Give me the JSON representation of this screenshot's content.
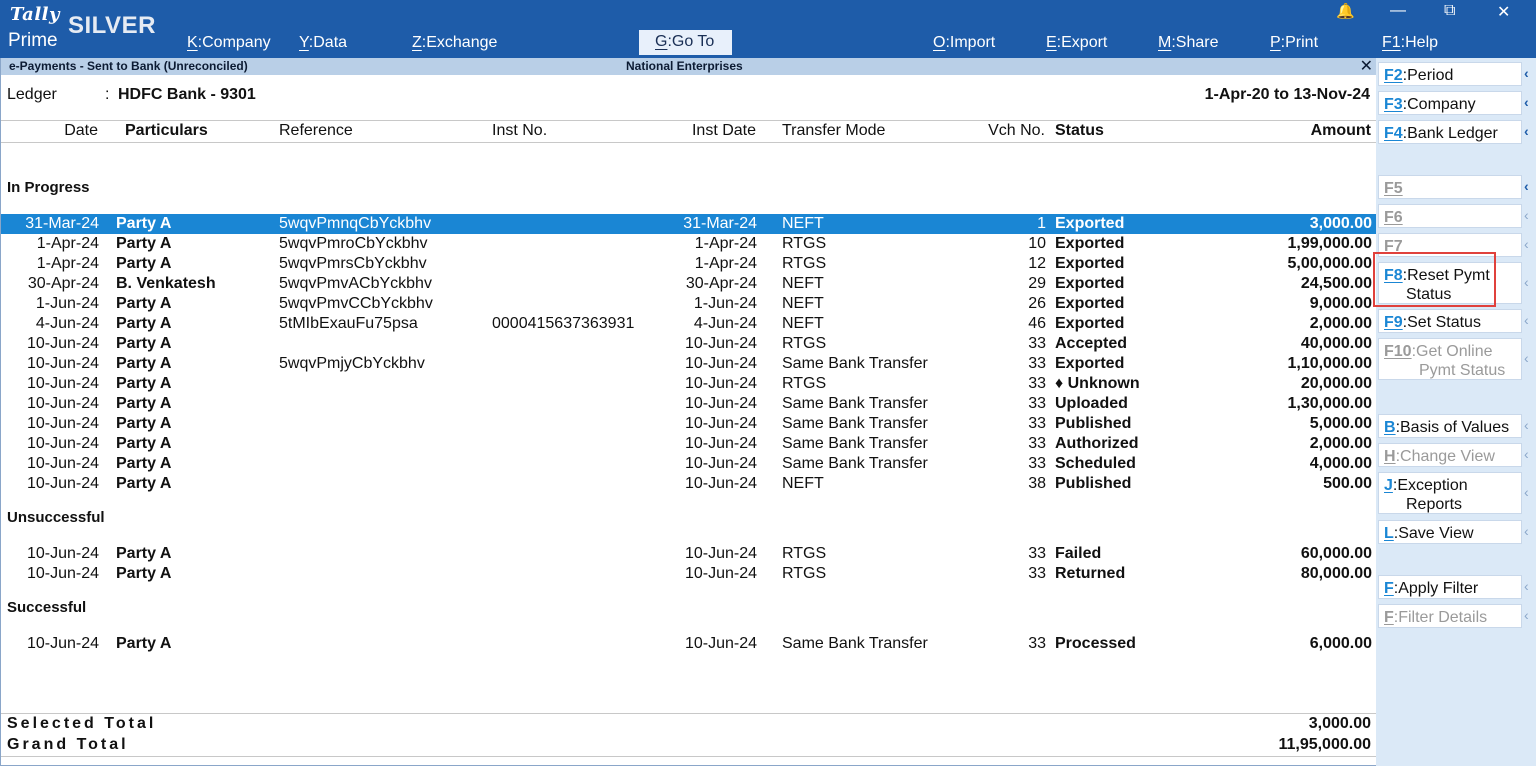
{
  "brand": {
    "tally": "Tally",
    "prime": "Prime",
    "edition": "SILVER"
  },
  "menu": [
    {
      "key": "K",
      "label": ":Company"
    },
    {
      "key": "Y",
      "label": ":Data"
    },
    {
      "key": "Z",
      "label": ":Exchange"
    },
    {
      "key": "G",
      "label": ":Go To"
    },
    {
      "key": "O",
      "label": ":Import"
    },
    {
      "key": "E",
      "label": ":Export"
    },
    {
      "key": "M",
      "label": ":Share"
    },
    {
      "key": "P",
      "label": ":Print"
    },
    {
      "key": "F1",
      "label": ":Help"
    }
  ],
  "window": {
    "bell": "🔔",
    "minimize": "—",
    "restore": "⧉",
    "close": "✕"
  },
  "report": {
    "title": "e-Payments - Sent to Bank (Unreconciled)",
    "company": "National Enterprises",
    "close": "✕",
    "ledger_label": "Ledger",
    "ledger_colon": ":",
    "ledger_value": "HDFC Bank - 9301",
    "period": "1-Apr-20 to 13-Nov-24"
  },
  "columns": {
    "date": "Date",
    "particulars": "Particulars",
    "reference": "Reference",
    "inst_no": "Inst No.",
    "inst_date": "Inst Date",
    "transfer_mode": "Transfer Mode",
    "vch_no": "Vch No.",
    "status": "Status",
    "amount": "Amount"
  },
  "sections": {
    "in_progress": "In Progress",
    "unsuccessful": "Unsuccessful",
    "successful": "Successful"
  },
  "rows_in_progress": [
    {
      "date": "31-Mar-24",
      "party": "Party A",
      "ref": "5wqvPmnqCbYckbhv",
      "inst": "",
      "idate": "31-Mar-24",
      "mode": "NEFT",
      "vch": "1",
      "status": "Exported",
      "amount": "3,000.00"
    },
    {
      "date": "1-Apr-24",
      "party": "Party A",
      "ref": "5wqvPmroCbYckbhv",
      "inst": "",
      "idate": "1-Apr-24",
      "mode": "RTGS",
      "vch": "10",
      "status": "Exported",
      "amount": "1,99,000.00"
    },
    {
      "date": "1-Apr-24",
      "party": "Party A",
      "ref": "5wqvPmrsCbYckbhv",
      "inst": "",
      "idate": "1-Apr-24",
      "mode": "RTGS",
      "vch": "12",
      "status": "Exported",
      "amount": "5,00,000.00"
    },
    {
      "date": "30-Apr-24",
      "party": "B. Venkatesh",
      "ref": "5wqvPmvACbYckbhv",
      "inst": "",
      "idate": "30-Apr-24",
      "mode": "NEFT",
      "vch": "29",
      "status": "Exported",
      "amount": "24,500.00"
    },
    {
      "date": "1-Jun-24",
      "party": "Party A",
      "ref": "5wqvPmvCCbYckbhv",
      "inst": "",
      "idate": "1-Jun-24",
      "mode": "NEFT",
      "vch": "26",
      "status": "Exported",
      "amount": "9,000.00"
    },
    {
      "date": "4-Jun-24",
      "party": "Party A",
      "ref": "5tMIbExauFu75psa",
      "inst": "0000415637363931",
      "idate": "4-Jun-24",
      "mode": "NEFT",
      "vch": "46",
      "status": "Exported",
      "amount": "2,000.00"
    },
    {
      "date": "10-Jun-24",
      "party": "Party A",
      "ref": "",
      "inst": "",
      "idate": "10-Jun-24",
      "mode": "RTGS",
      "vch": "33",
      "status": "Accepted",
      "amount": "40,000.00"
    },
    {
      "date": "10-Jun-24",
      "party": "Party A",
      "ref": "5wqvPmjyCbYckbhv",
      "inst": "",
      "idate": "10-Jun-24",
      "mode": "Same Bank Transfer",
      "vch": "33",
      "status": "Exported",
      "amount": "1,10,000.00"
    },
    {
      "date": "10-Jun-24",
      "party": "Party A",
      "ref": "",
      "inst": "",
      "idate": "10-Jun-24",
      "mode": "RTGS",
      "vch": "33",
      "status": "♦ Unknown",
      "amount": "20,000.00"
    },
    {
      "date": "10-Jun-24",
      "party": "Party A",
      "ref": "",
      "inst": "",
      "idate": "10-Jun-24",
      "mode": "Same Bank Transfer",
      "vch": "33",
      "status": "Uploaded",
      "amount": "1,30,000.00"
    },
    {
      "date": "10-Jun-24",
      "party": "Party A",
      "ref": "",
      "inst": "",
      "idate": "10-Jun-24",
      "mode": "Same Bank Transfer",
      "vch": "33",
      "status": "Published",
      "amount": "5,000.00"
    },
    {
      "date": "10-Jun-24",
      "party": "Party A",
      "ref": "",
      "inst": "",
      "idate": "10-Jun-24",
      "mode": "Same Bank Transfer",
      "vch": "33",
      "status": "Authorized",
      "amount": "2,000.00"
    },
    {
      "date": "10-Jun-24",
      "party": "Party A",
      "ref": "",
      "inst": "",
      "idate": "10-Jun-24",
      "mode": "Same Bank Transfer",
      "vch": "33",
      "status": "Scheduled",
      "amount": "4,000.00"
    },
    {
      "date": "10-Jun-24",
      "party": "Party A",
      "ref": "",
      "inst": "",
      "idate": "10-Jun-24",
      "mode": "NEFT",
      "vch": "38",
      "status": "Published",
      "amount": "500.00"
    }
  ],
  "rows_unsuccessful": [
    {
      "date": "10-Jun-24",
      "party": "Party A",
      "ref": "",
      "inst": "",
      "idate": "10-Jun-24",
      "mode": "RTGS",
      "vch": "33",
      "status": "Failed",
      "amount": "60,000.00"
    },
    {
      "date": "10-Jun-24",
      "party": "Party A",
      "ref": "",
      "inst": "",
      "idate": "10-Jun-24",
      "mode": "RTGS",
      "vch": "33",
      "status": "Returned",
      "amount": "80,000.00"
    }
  ],
  "rows_successful": [
    {
      "date": "10-Jun-24",
      "party": "Party A",
      "ref": "",
      "inst": "",
      "idate": "10-Jun-24",
      "mode": "Same Bank Transfer",
      "vch": "33",
      "status": "Processed",
      "amount": "6,000.00"
    }
  ],
  "totals": {
    "selected_label": "Selected Total",
    "selected_amount": "3,000.00",
    "grand_label": "Grand Total",
    "grand_amount": "11,95,000.00"
  },
  "side_buttons": [
    {
      "key": "F2",
      "label": ":Period",
      "enabled": true
    },
    {
      "key": "F3",
      "label": ":Company",
      "enabled": true
    },
    {
      "key": "F4",
      "label": ":Bank Ledger",
      "enabled": true
    },
    {
      "key": "F5",
      "label": "",
      "enabled": false
    },
    {
      "key": "F6",
      "label": "",
      "enabled": false
    },
    {
      "key": "F7",
      "label": "",
      "enabled": false
    },
    {
      "key": "F8",
      "label": ":Reset Pymt",
      "label2": "Status",
      "enabled": true
    },
    {
      "key": "F9",
      "label": ":Set Status",
      "enabled": true
    },
    {
      "key": "F10",
      "label": ":Get Online",
      "label2": "Pymt Status",
      "enabled": false
    },
    {
      "key": "B",
      "label": ":Basis of Values",
      "enabled": true
    },
    {
      "key": "H",
      "label": ":Change View",
      "enabled": false
    },
    {
      "key": "J",
      "label": ":Exception",
      "label2": "Reports",
      "enabled": true
    },
    {
      "key": "L",
      "label": ":Save View",
      "enabled": true
    },
    {
      "key": "F",
      "label": ":Apply Filter",
      "enabled": true
    },
    {
      "key": "F",
      "label": ":Filter Details",
      "enabled": false
    }
  ],
  "chevron": "‹",
  "colors": {
    "topbar": "#1e5ca9",
    "selected_row": "#1a86d4",
    "side_panel": "#dbe9f7",
    "highlight": "#e0413c"
  }
}
